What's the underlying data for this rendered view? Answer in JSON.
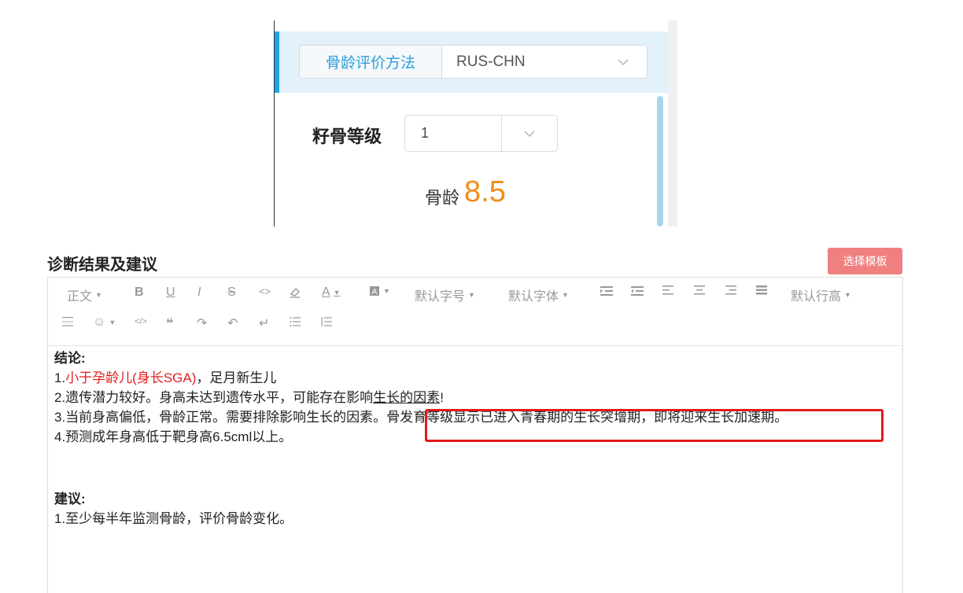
{
  "panel": {
    "method_label": "骨龄评价方法",
    "method_value": "RUS-CHN",
    "grade_label": "籽骨等级",
    "grade_value": "1",
    "age_label": "骨龄",
    "age_value": "8.5",
    "colors": {
      "accent": "#1fa3e8",
      "age_value": "#f28c1a"
    }
  },
  "section": {
    "title": "诊断结果及建议",
    "template_button": "选择模板",
    "template_button_color": "#f08080"
  },
  "toolbar": {
    "row1": [
      "正文",
      "B",
      "U",
      "I",
      "S",
      "<>",
      "eraser",
      "A",
      "bg-color",
      "默认字号",
      "默认字体",
      "indent",
      "outdent",
      "align-left",
      "align-center",
      "align-right",
      "justify",
      "默认行高"
    ],
    "paragraph": "正文",
    "font_size": "默认字号",
    "font_family": "默认字体",
    "line_height": "默认行高"
  },
  "content": {
    "conclusion_head": "结论:",
    "line1_prefix": "1.",
    "line1_red": "小于孕龄儿(身长SGA)",
    "line1_rest": "，足月新生儿",
    "line2_a": "2.遗传潜力较好。身高未达到遗传水平，可能存在影响",
    "line2_b": "生长的因素",
    "line2_c": "!",
    "line3_a": "3.当前身高偏低，骨龄正常。需要排除影响生长的因素。",
    "line3_b": "骨发育等级显示已进入青春期的生长突增期，即将迎来生长加速期。",
    "line4": "4.预测成年身高低于靶身高6.5cml以上。",
    "advice_head": "建议:",
    "advice1": "1.至少每半年监测骨龄，评价骨龄变化。",
    "highlight_color": "#e11b1b"
  }
}
